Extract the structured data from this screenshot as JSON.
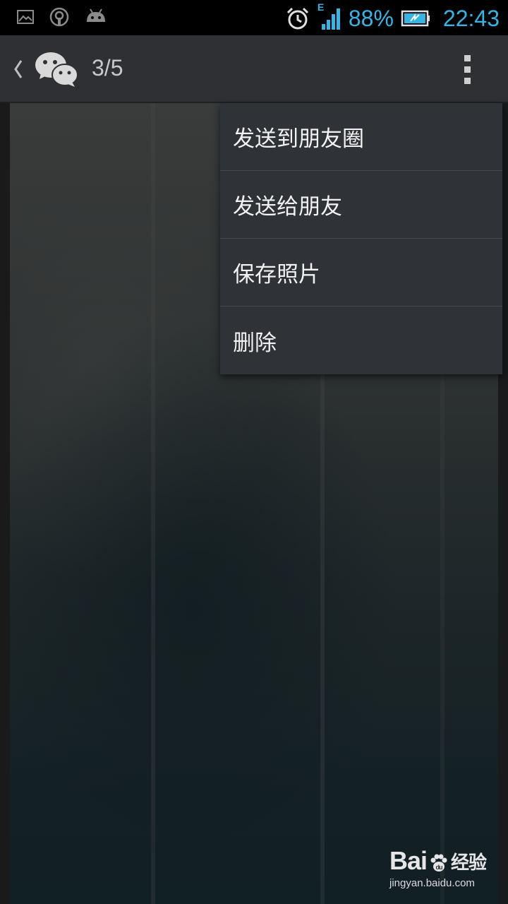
{
  "status_bar": {
    "battery_percent": "88%",
    "time": "22:43",
    "network_type": "E",
    "icons": [
      "gallery-notification-icon",
      "podcast-notification-icon",
      "android-notification-icon",
      "alarm-icon",
      "signal-icon",
      "battery-icon"
    ],
    "accent_color": "#33b5e5"
  },
  "action_bar": {
    "counter": "3/5",
    "icons": [
      "back-arrow-icon",
      "wechat-logo-icon",
      "overflow-menu-icon"
    ]
  },
  "menu": {
    "items": [
      {
        "label": "发送到朋友圈"
      },
      {
        "label": "发送给朋友"
      },
      {
        "label": "保存照片"
      },
      {
        "label": "删除"
      }
    ]
  },
  "watermark": {
    "logo_prefix": "Bai",
    "logo_suffix": "经验",
    "subtext": "jingyan.baidu.com"
  }
}
